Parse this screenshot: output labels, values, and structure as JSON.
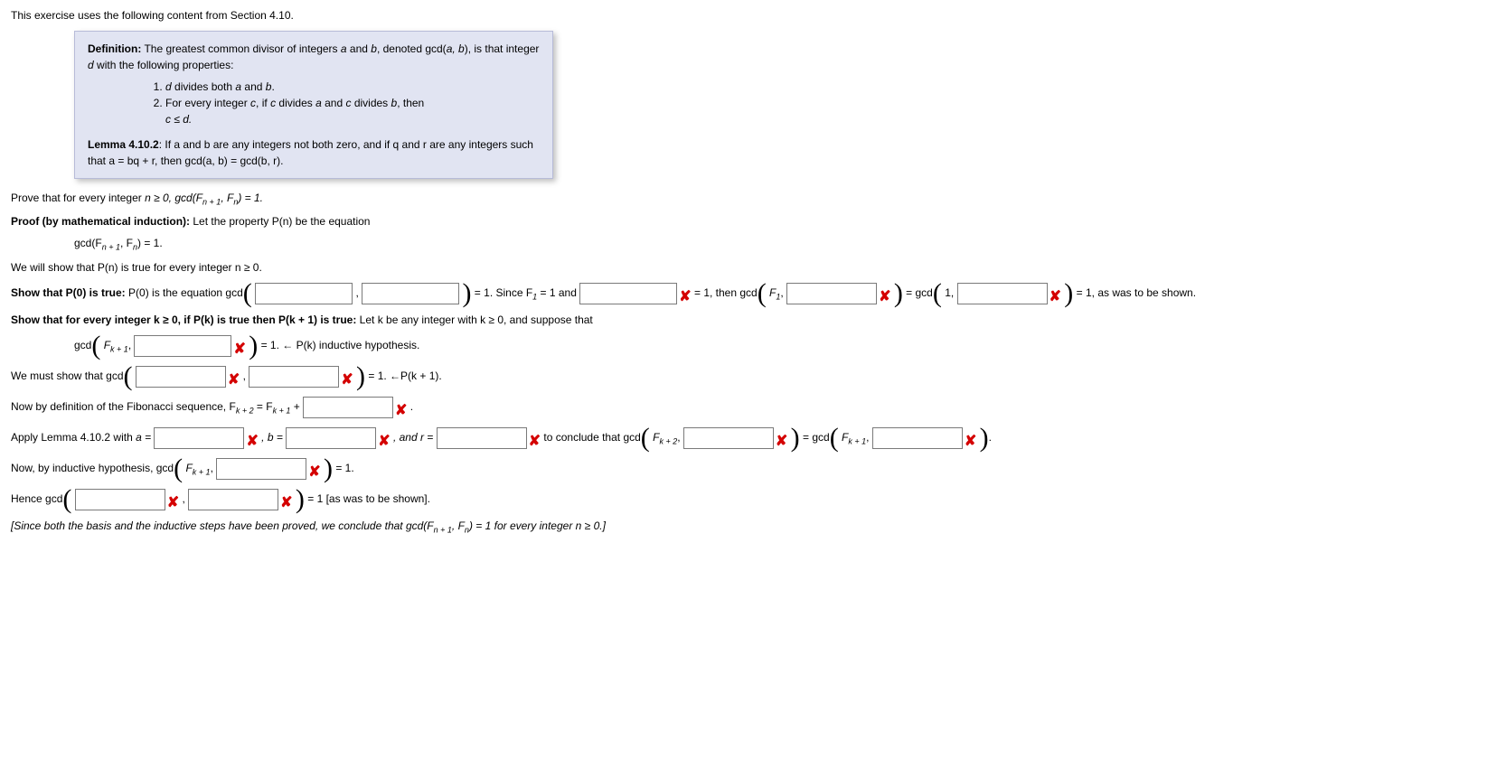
{
  "intro": "This exercise uses the following content from Section 4.10.",
  "defbox": {
    "def_head": "Definition:",
    "def_body_before": " The greatest common divisor of integers ",
    "def_a": "a",
    "def_and": " and ",
    "def_b": "b",
    "def_body_mid": ", denoted gcd(",
    "def_ab": "a, b",
    "def_body_after": "), is that integer ",
    "def_d": "d",
    "def_tail": " with the following properties:",
    "li1_a": "d",
    "li1_mid": " divides both ",
    "li1_b": "a",
    "li1_and": " and ",
    "li1_c": "b",
    "li1_end": ".",
    "li2_pre": "For every integer ",
    "li2_c": "c",
    "li2_mid1": ", if ",
    "li2_c2": "c",
    "li2_mid2": " divides ",
    "li2_a": "a",
    "li2_mid3": " and ",
    "li2_c3": "c",
    "li2_mid4": " divides ",
    "li2_b": "b",
    "li2_then": ", then ",
    "li2_ineq": "c ≤ d.",
    "lemma_head": "Lemma 4.10.2",
    "lemma_body": ": If a and b are any integers not both zero, and if q and r are any integers such that a = bq + r, then gcd(a, b) = gcd(b, r)."
  },
  "prove_pre": "Prove that for every integer ",
  "prove_n": "n ≥ 0, gcd(F",
  "prove_sub1": "n + 1",
  "prove_mid": ", F",
  "prove_sub2": "n",
  "prove_end": ") = 1.",
  "proof_head": "Proof (by mathematical induction):",
  "proof_body": " Let the property P(n) be the equation",
  "pn_eq_pre": "gcd(F",
  "pn_eq_s1": "n + 1",
  "pn_eq_mid": ", F",
  "pn_eq_s2": "n",
  "pn_eq_end": ") = 1.",
  "show_all": "We will show that P(n) is true for every integer n ≥ 0.",
  "base_head": "Show that P(0) is true:",
  "base_body": " P(0) is the equation gcd",
  "base_eq1": " = 1. Since F",
  "base_sub1": "1",
  "base_eq1b": " = 1 and ",
  "base_eq2": " = 1, then gcd",
  "base_F1": "F",
  "base_F1s": "1",
  "base_comma": ", ",
  "base_eqgcd": " = gcd",
  "base_one": "1, ",
  "base_eqshown": " = 1, as was to be shown.",
  "ind_head": "Show that for every integer k ≥ 0, if P(k) is true then P(k + 1) is true:",
  "ind_body": " Let k be any integer with k ≥ 0, and suppose that",
  "ind_gcd": "gcd",
  "ind_F": "F",
  "ind_k1": "k + 1",
  "ind_eq1": " = 1.    ← P(k) inductive hypothesis.",
  "must_pre": "We must show that gcd",
  "must_eq": " = 1.    ←P(k + 1).",
  "fib_pre": "Now by definition of the Fibonacci sequence, F",
  "fib_s1": "k + 2",
  "fib_mid": " = F",
  "fib_s2": "k + 1",
  "fib_plus": " + ",
  "fib_end": " .",
  "lemma_apply_pre": "Apply Lemma 4.10.2 with ",
  "lemma_a": "a = ",
  "lemma_b": " , b = ",
  "lemma_r": " , and r = ",
  "lemma_conc": " to conclude that gcd",
  "lemma_F": "F",
  "lemma_k2": "k + 2",
  "lemma_eqgcd": " = gcd",
  "lemma_k1": "k + 1",
  "lemma_dot": ".",
  "now_pre": "Now, by inductive hypothesis, gcd",
  "now_F": "F",
  "now_k1": "k + 1",
  "now_eq": " = 1.",
  "hence_pre": "Hence gcd",
  "hence_eq": " = 1 [as was to be shown].",
  "conclusion": "[Since both the basis and the inductive steps have been proved, we conclude that gcd(F",
  "conc_s1": "n + 1",
  "conc_mid": ", F",
  "conc_s2": "n",
  "conc_end": ") = 1 for every integer n ≥ 0.]"
}
